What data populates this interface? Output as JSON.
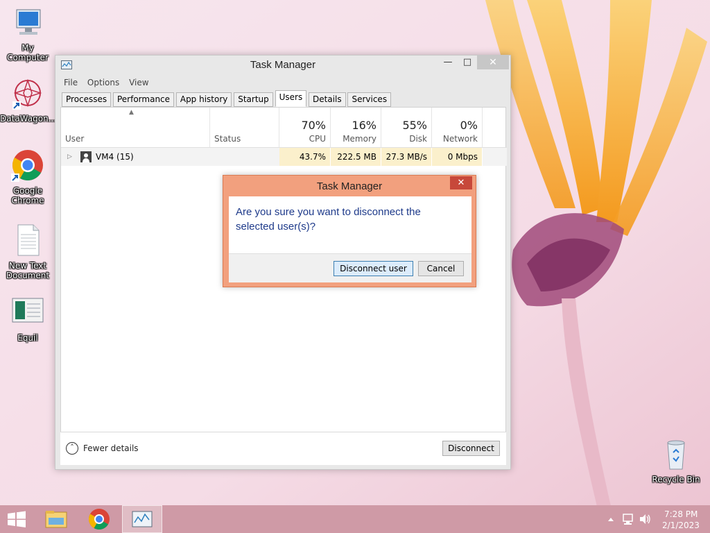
{
  "desktop": {
    "icons": [
      {
        "label": "My Computer",
        "icon": "computer-icon"
      },
      {
        "label": "DataWagon...",
        "icon": "datawagon-icon"
      },
      {
        "label_line1": "Google",
        "label_line2": "Chrome",
        "icon": "chrome-icon"
      },
      {
        "label_line1": "New Text",
        "label_line2": "Document",
        "icon": "text-document-icon"
      },
      {
        "label": "Equil",
        "icon": "equil-icon"
      },
      {
        "label": "Recycle Bin",
        "icon": "recycle-bin-icon"
      }
    ]
  },
  "task_manager": {
    "title": "Task Manager",
    "menu": [
      "File",
      "Options",
      "View"
    ],
    "tabs": [
      "Processes",
      "Performance",
      "App history",
      "Startup",
      "Users",
      "Details",
      "Services"
    ],
    "active_tab": "Users",
    "columns": {
      "user": "User",
      "status": "Status",
      "cpu": {
        "percent": "70%",
        "label": "CPU"
      },
      "memory": {
        "percent": "16%",
        "label": "Memory"
      },
      "disk": {
        "percent": "55%",
        "label": "Disk"
      },
      "network": {
        "percent": "0%",
        "label": "Network"
      }
    },
    "rows": [
      {
        "name": "VM4 (15)",
        "status": "",
        "cpu": "43.7%",
        "memory": "222.5 MB",
        "disk": "27.3 MB/s",
        "network": "0 Mbps"
      }
    ],
    "footer": {
      "fewer_details": "Fewer details",
      "disconnect": "Disconnect"
    }
  },
  "dialog": {
    "title": "Task Manager",
    "message": "Are you sure you want to disconnect the selected user(s)?",
    "confirm": "Disconnect user",
    "cancel": "Cancel"
  },
  "taskbar": {
    "time": "7:28 PM",
    "date": "2/1/2023",
    "pinned": [
      "windows-start-icon",
      "file-explorer-icon",
      "chrome-icon",
      "task-manager-icon"
    ]
  },
  "colors": {
    "taskbar": "#cf9aa6",
    "dialog_frame": "#f2a07e",
    "dialog_close": "#c7483a",
    "heat_cell": "#fbf0cc",
    "message_text": "#1e3a8a"
  }
}
